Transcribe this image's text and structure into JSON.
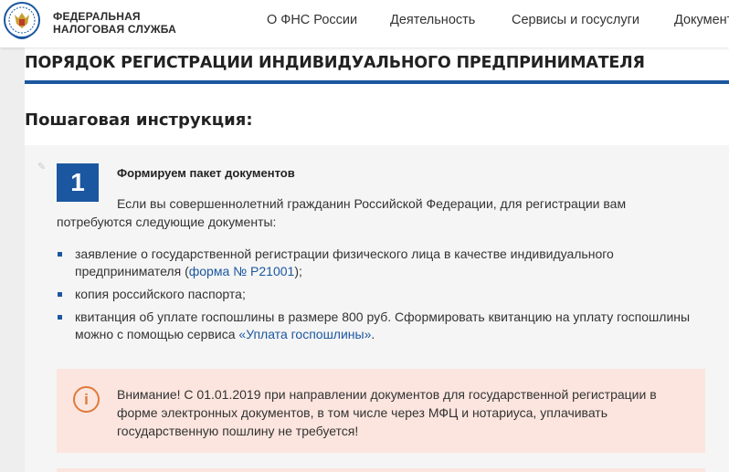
{
  "header": {
    "logo_line1": "ФЕДЕРАЛЬНАЯ",
    "logo_line2": "НАЛОГОВАЯ СЛУЖБА",
    "nav": [
      {
        "label": "О ФНС России"
      },
      {
        "label": "Деятельность"
      },
      {
        "label": "Сервисы и госуслуги"
      },
      {
        "label": "Документ"
      }
    ]
  },
  "page": {
    "title": "ПОРЯДОК РЕГИСТРАЦИИ ИНДИВИДУАЛЬНОГО ПРЕДПРИНИМАТЕЛЯ",
    "subtitle": "Пошаговая инструкция:"
  },
  "step": {
    "number": "1",
    "title": "Формируем пакет документов",
    "intro": "Если вы совершеннолетний гражданин Российской Федерации, для регистрации вам потребуются следующие документы:",
    "items": [
      {
        "text_before": "заявление о государственной регистрации физического лица в качестве индивидуального предпринимателя (",
        "link": "форма № Р21001",
        "text_after": ");"
      },
      {
        "text_before": "копия российского паспорта;",
        "link": "",
        "text_after": ""
      },
      {
        "text_before": "квитанция об уплате госпошлины в размере 800 руб. Сформировать квитанцию на уплату госпошлины можно с помощью сервиса ",
        "link": "«Уплата госпошлины»",
        "text_after": "."
      }
    ],
    "notice": {
      "icon": "i",
      "text": "Внимание! С 01.01.2019 при направлении документов для государственной регистрации в форме электронных документов, в том числе через МФЦ и нотариуса, уплачивать государственную пошлину не требуется!"
    }
  },
  "colors": {
    "brand_blue": "#1b57a0",
    "notice_bg": "#fbe5de",
    "notice_accent": "#e07a3c",
    "step_bg": "#f5f5f5"
  }
}
